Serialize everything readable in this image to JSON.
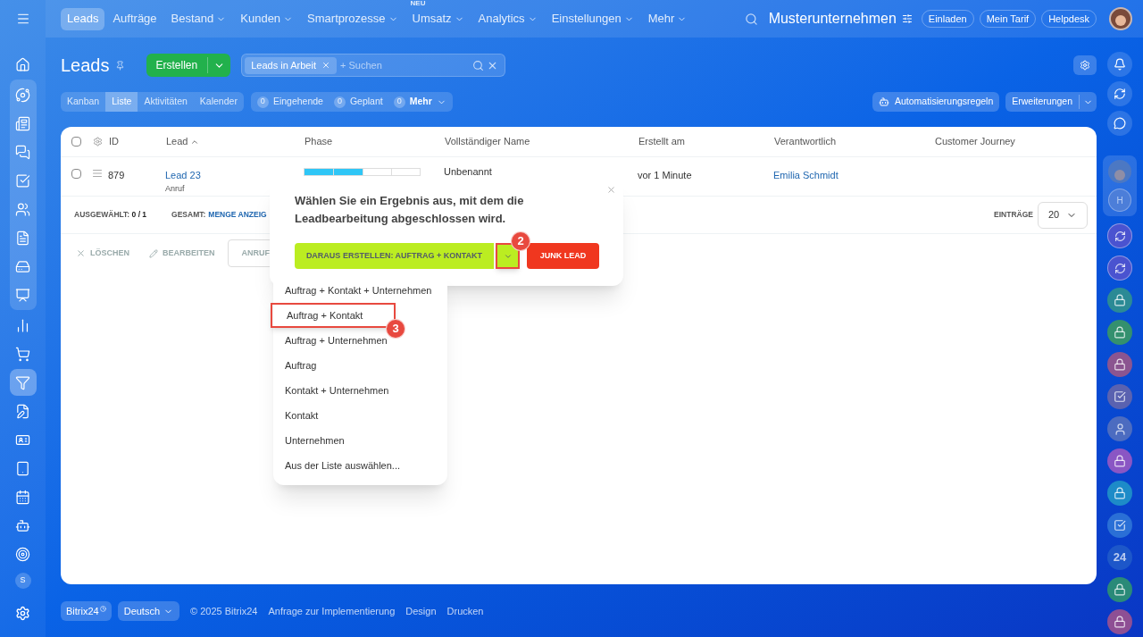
{
  "top_nav": {
    "tabs": [
      {
        "label": "Leads",
        "selected": true,
        "dropdown": false
      },
      {
        "label": "Aufträge",
        "selected": false,
        "dropdown": false
      },
      {
        "label": "Bestand",
        "selected": false,
        "dropdown": true
      },
      {
        "label": "Kunden",
        "selected": false,
        "dropdown": true
      },
      {
        "label": "Smartprozesse",
        "selected": false,
        "dropdown": true
      },
      {
        "label": "Umsatz",
        "selected": false,
        "dropdown": true,
        "badge": "NEU"
      },
      {
        "label": "Analytics",
        "selected": false,
        "dropdown": true
      },
      {
        "label": "Einstellungen",
        "selected": false,
        "dropdown": true
      },
      {
        "label": "Mehr",
        "selected": false,
        "dropdown": true
      }
    ],
    "company": "Musterunternehmen",
    "buttons": [
      "Einladen",
      "Mein Tarif",
      "Helpdesk"
    ]
  },
  "sidebar": {
    "top_items": [
      {
        "selected": false
      }
    ],
    "group": [
      {
        "selected": false
      },
      {
        "selected": false
      },
      {
        "selected": false
      },
      {
        "selected": false
      },
      {
        "selected": false
      },
      {
        "selected": false
      },
      {
        "selected": false
      },
      {
        "selected": false
      }
    ],
    "bottom_items": [
      {
        "selected": false
      },
      {
        "selected": false
      },
      {
        "selected": true
      },
      {
        "selected": false
      },
      {
        "selected": false
      },
      {
        "selected": false
      },
      {
        "selected": false
      },
      {
        "selected": false
      },
      {
        "selected": false
      }
    ],
    "avatar_letter": "S"
  },
  "page": {
    "title": "Leads",
    "create_button": "Erstellen",
    "filter": {
      "chip": "Leads in Arbeit",
      "placeholder": "+ Suchen"
    },
    "views": [
      {
        "label": "Kanban",
        "selected": false
      },
      {
        "label": "Liste",
        "selected": true
      },
      {
        "label": "Aktivitäten",
        "selected": false
      },
      {
        "label": "Kalender",
        "selected": false
      }
    ],
    "counters": [
      {
        "count": "0",
        "label": "Eingehende",
        "dropdown": false
      },
      {
        "count": "0",
        "label": "Geplant",
        "dropdown": false
      },
      {
        "count": "0",
        "label": "Mehr",
        "dropdown": true
      }
    ],
    "automation_button": "Automatisierungsregeln",
    "extensions_button": "Erweiterungen"
  },
  "table": {
    "all_checked": false,
    "columns": [
      {
        "label": "ID",
        "sorted": false
      },
      {
        "label": "Lead",
        "sorted": true
      },
      {
        "label": "Phase",
        "sorted": false
      },
      {
        "label": "Vollständiger Name",
        "sorted": false
      },
      {
        "label": "Erstellt am",
        "sorted": false
      },
      {
        "label": "Verantwortlich",
        "sorted": false
      },
      {
        "label": "Customer Journey",
        "sorted": false
      }
    ],
    "rows": [
      {
        "checked": false,
        "id": "879",
        "lead": "Lead 23",
        "source": "Anruf",
        "level": 0.5,
        "name": "Unbenannt",
        "created": "vor 1 Minute",
        "responsible": "Emilia Schmidt"
      }
    ],
    "selected_count": {
      "label": "AUSGEWÄHLT:",
      "value": "0 / 1"
    },
    "total": {
      "label": "GESAMT:",
      "link": "MENGE ANZEIG"
    },
    "page_size": {
      "label": "EINTRÄGE",
      "value": "20"
    },
    "actions": [
      {
        "label": "LÖSCHEN",
        "kind": "delete"
      },
      {
        "label": "BEARBEITEN",
        "kind": "edit"
      },
      {
        "label": "ANRUF",
        "kind": "outlined"
      }
    ]
  },
  "popup": {
    "message": "Wählen Sie ein Ergebnis aus, mit dem die Leadbearbeitung abgeschlossen wird.",
    "primary_button": "DARAUS ERSTELLEN: AUFTRAG + KONTAKT",
    "caret_highlighted": true,
    "secondary_button": "JUNK LEAD",
    "callout": "2"
  },
  "dropdown": {
    "items": [
      {
        "label": "Auftrag + Kontakt + Unternehmen",
        "highlighted": false
      },
      {
        "label": "Auftrag + Kontakt",
        "highlighted": true
      },
      {
        "label": "Auftrag + Unternehmen",
        "highlighted": false
      },
      {
        "label": "Auftrag",
        "highlighted": false
      },
      {
        "label": "Kontakt + Unternehmen",
        "highlighted": false
      },
      {
        "label": "Kontakt",
        "highlighted": false
      },
      {
        "label": "Unternehmen",
        "highlighted": false
      },
      {
        "label": "Aus der Liste auswählen...",
        "highlighted": false
      }
    ],
    "callout": "3"
  },
  "right_rail": {
    "group_letter": "H",
    "items": [
      {
        "kind": "spiral",
        "color": "#4a53d0"
      },
      {
        "kind": "spiral",
        "color": "#4a53d0"
      },
      {
        "kind": "lock",
        "color": "#2b8a95"
      },
      {
        "kind": "lock",
        "color": "#34906e"
      },
      {
        "kind": "lock",
        "color": "#8b5590"
      },
      {
        "kind": "check",
        "color": "#5a62b0"
      },
      {
        "kind": "avatar",
        "color": "#4c6cc0"
      },
      {
        "kind": "lock",
        "color": "#8a56c4"
      },
      {
        "kind": "lock",
        "color": "#1d8bc8"
      },
      {
        "kind": "check",
        "color": "#2a6fd6"
      },
      {
        "kind": "number",
        "color": "#1d57c9",
        "text": "24"
      },
      {
        "kind": "lock",
        "color": "#2a8a78"
      },
      {
        "kind": "lock",
        "color": "#8e4f94"
      }
    ]
  },
  "footer": {
    "brand": "Bitrix24",
    "language": "Deutsch",
    "links": [
      "© 2025 Bitrix24",
      "Anfrage zur Implementierung",
      "Design",
      "Drucken"
    ]
  }
}
